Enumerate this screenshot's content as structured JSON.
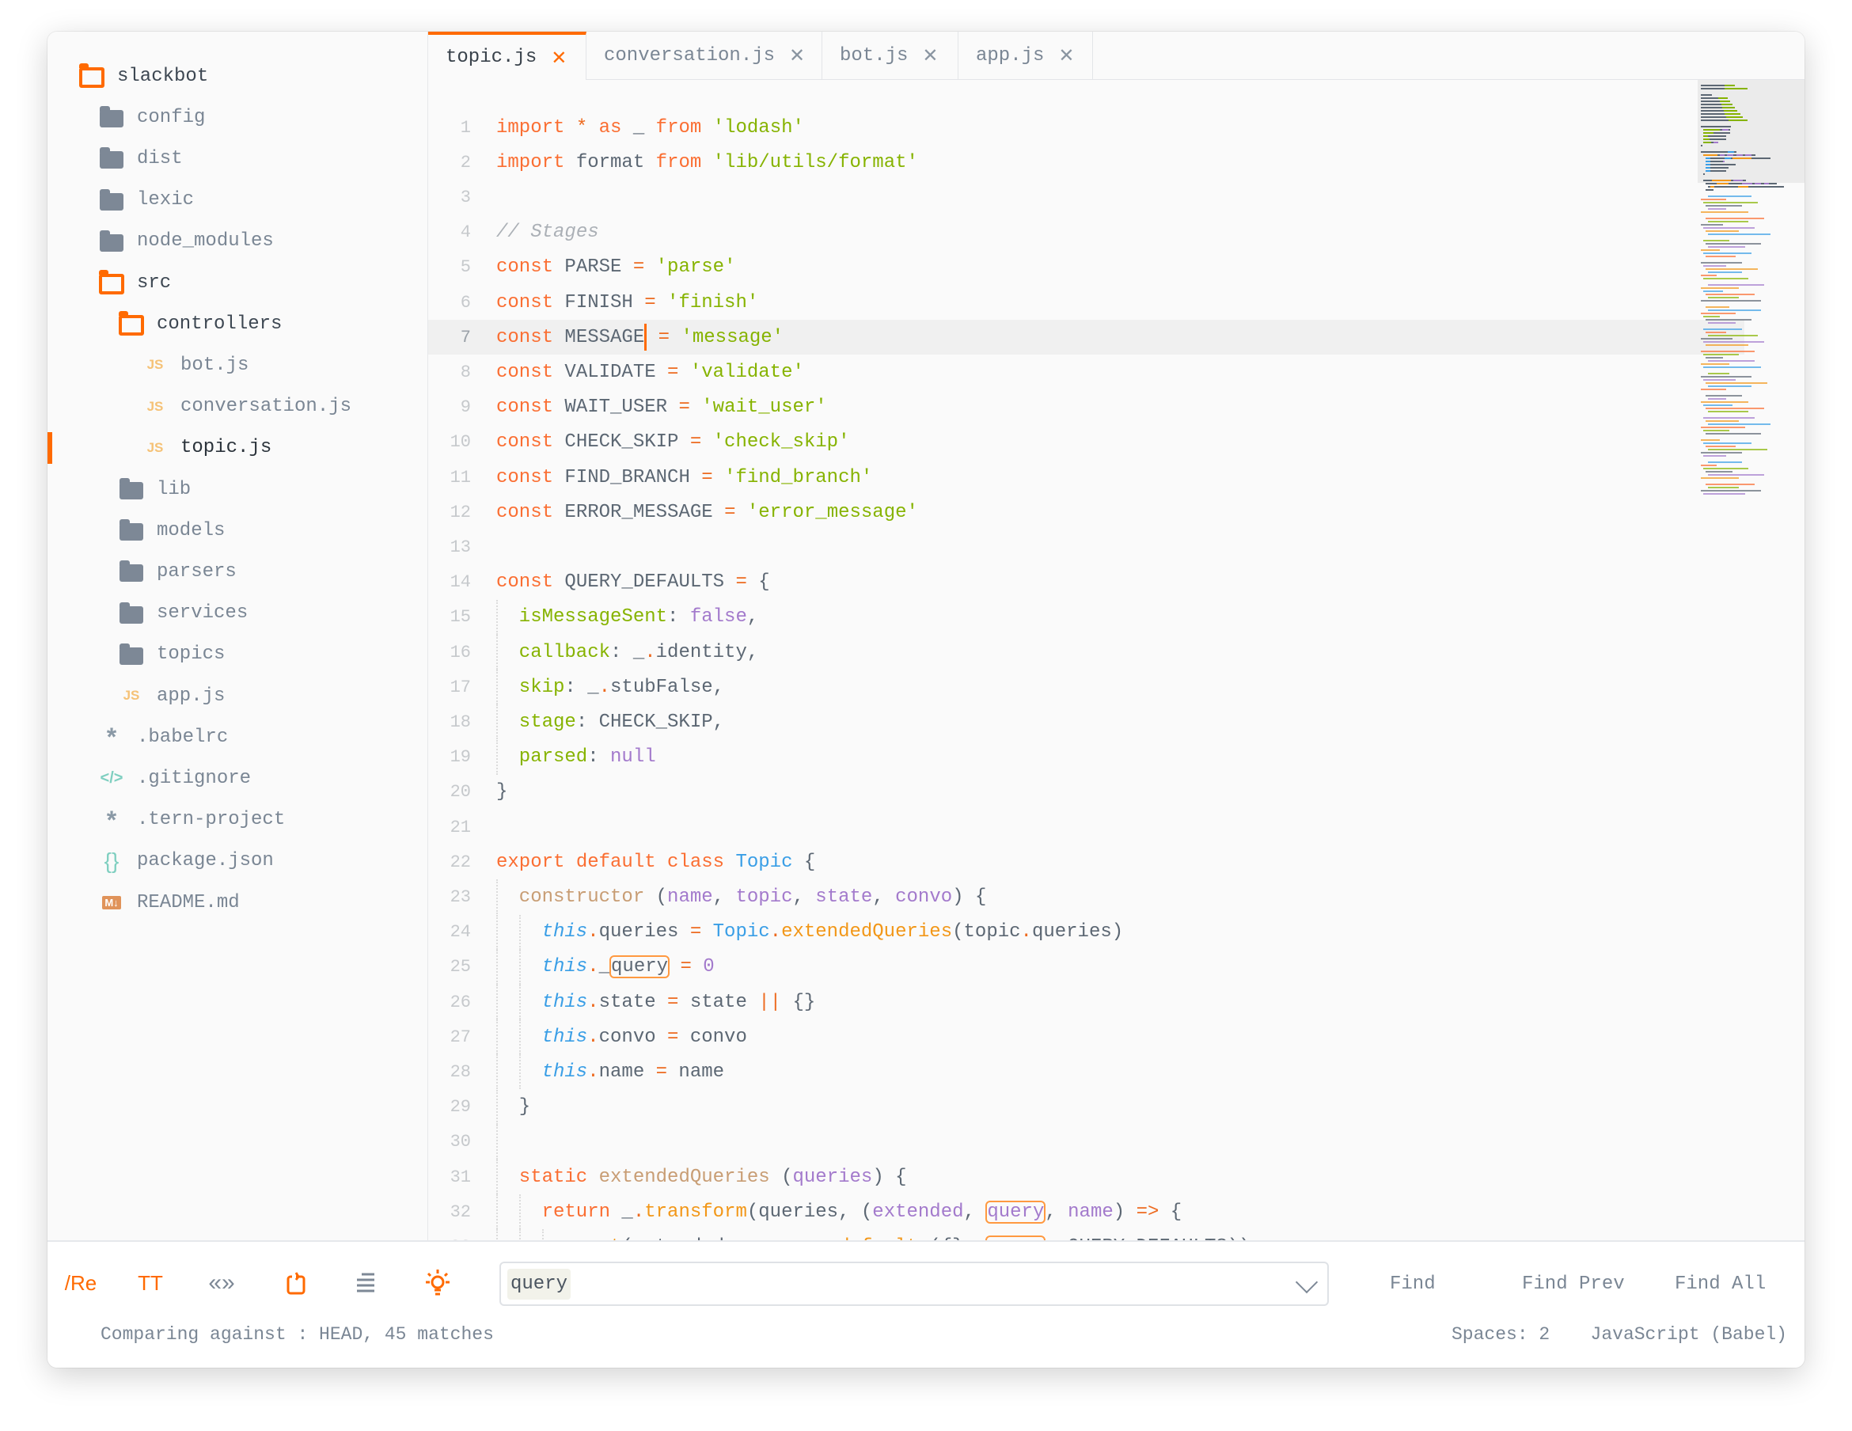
{
  "colors": {
    "accent": "#ff6a00",
    "keyword": "#fa6e32",
    "string": "#86b300",
    "function": "#f29718",
    "class": "#399ee6",
    "param": "#a37acc",
    "comment": "#abb0b6"
  },
  "sidebar": {
    "items": [
      {
        "label": "slackbot",
        "icon": "folder-open-icon",
        "level": 0,
        "open": true
      },
      {
        "label": "config",
        "icon": "folder-icon",
        "level": 1
      },
      {
        "label": "dist",
        "icon": "folder-icon",
        "level": 1
      },
      {
        "label": "lexic",
        "icon": "folder-icon",
        "level": 1
      },
      {
        "label": "node_modules",
        "icon": "folder-icon",
        "level": 1
      },
      {
        "label": "src",
        "icon": "folder-open-icon",
        "level": 1,
        "open": true
      },
      {
        "label": "controllers",
        "icon": "folder-open-icon",
        "level": 2,
        "open": true
      },
      {
        "label": "bot.js",
        "icon": "js-file-icon",
        "level": 3
      },
      {
        "label": "conversation.js",
        "icon": "js-file-icon",
        "level": 3
      },
      {
        "label": "topic.js",
        "icon": "js-file-icon",
        "level": 3,
        "active": true
      },
      {
        "label": "lib",
        "icon": "folder-icon",
        "level": 2
      },
      {
        "label": "models",
        "icon": "folder-icon",
        "level": 2
      },
      {
        "label": "parsers",
        "icon": "folder-icon",
        "level": 2
      },
      {
        "label": "services",
        "icon": "folder-icon",
        "level": 2
      },
      {
        "label": "topics",
        "icon": "folder-icon",
        "level": 2
      },
      {
        "label": "app.js",
        "icon": "js-file-icon",
        "level": 2
      },
      {
        "label": ".babelrc",
        "icon": "asterisk-icon",
        "level": 1
      },
      {
        "label": ".gitignore",
        "icon": "code-icon",
        "level": 1
      },
      {
        "label": ".tern-project",
        "icon": "asterisk-icon",
        "level": 1
      },
      {
        "label": "package.json",
        "icon": "braces-icon",
        "level": 1
      },
      {
        "label": "README.md",
        "icon": "markdown-icon",
        "level": 1
      }
    ]
  },
  "tabs": [
    {
      "label": "topic.js",
      "active": true
    },
    {
      "label": "conversation.js"
    },
    {
      "label": "bot.js"
    },
    {
      "label": "app.js"
    }
  ],
  "editor": {
    "current_line": 7,
    "lines": [
      [
        [
          "kw",
          "import"
        ],
        [
          "op",
          " * "
        ],
        [
          "kw",
          "as"
        ],
        [
          "p",
          " _ "
        ],
        [
          "kw",
          "from"
        ],
        [
          "p",
          " "
        ],
        [
          "str",
          "'lodash'"
        ]
      ],
      [
        [
          "kw",
          "import"
        ],
        [
          "p",
          " format "
        ],
        [
          "kw",
          "from"
        ],
        [
          "p",
          " "
        ],
        [
          "str",
          "'lib/utils/format'"
        ]
      ],
      [],
      [
        [
          "cm",
          "// Stages"
        ]
      ],
      [
        [
          "kw",
          "const"
        ],
        [
          "p",
          " PARSE "
        ],
        [
          "op",
          "="
        ],
        [
          "p",
          " "
        ],
        [
          "str",
          "'parse'"
        ]
      ],
      [
        [
          "kw",
          "const"
        ],
        [
          "p",
          " FINISH "
        ],
        [
          "op",
          "="
        ],
        [
          "p",
          " "
        ],
        [
          "str",
          "'finish'"
        ]
      ],
      [
        [
          "kw",
          "const"
        ],
        [
          "p",
          " MESSAGE"
        ],
        [
          "cur",
          ""
        ],
        [
          "p",
          " "
        ],
        [
          "op",
          "="
        ],
        [
          "p",
          " "
        ],
        [
          "str",
          "'message'"
        ]
      ],
      [
        [
          "kw",
          "const"
        ],
        [
          "p",
          " VALIDATE "
        ],
        [
          "op",
          "="
        ],
        [
          "p",
          " "
        ],
        [
          "str",
          "'validate'"
        ]
      ],
      [
        [
          "kw",
          "const"
        ],
        [
          "p",
          " WAIT_USER "
        ],
        [
          "op",
          "="
        ],
        [
          "p",
          " "
        ],
        [
          "str",
          "'wait_user'"
        ]
      ],
      [
        [
          "kw",
          "const"
        ],
        [
          "p",
          " CHECK_SKIP "
        ],
        [
          "op",
          "="
        ],
        [
          "p",
          " "
        ],
        [
          "str",
          "'check_skip'"
        ]
      ],
      [
        [
          "kw",
          "const"
        ],
        [
          "p",
          " FIND_BRANCH "
        ],
        [
          "op",
          "="
        ],
        [
          "p",
          " "
        ],
        [
          "str",
          "'find_branch'"
        ]
      ],
      [
        [
          "kw",
          "const"
        ],
        [
          "p",
          " ERROR_MESSAGE "
        ],
        [
          "op",
          "="
        ],
        [
          "p",
          " "
        ],
        [
          "str",
          "'error_message'"
        ]
      ],
      [],
      [
        [
          "kw",
          "const"
        ],
        [
          "p",
          " QUERY_DEFAULTS "
        ],
        [
          "op",
          "="
        ],
        [
          "p",
          " {"
        ]
      ],
      [
        [
          "ind",
          1
        ],
        [
          "prop",
          "isMessageSent"
        ],
        [
          "p",
          ": "
        ],
        [
          "num",
          "false"
        ],
        [
          "p",
          ","
        ]
      ],
      [
        [
          "ind",
          1
        ],
        [
          "prop",
          "callback"
        ],
        [
          "p",
          ": _"
        ],
        [
          "op",
          "."
        ],
        [
          "p",
          "identity,"
        ]
      ],
      [
        [
          "ind",
          1
        ],
        [
          "prop",
          "skip"
        ],
        [
          "p",
          ": _"
        ],
        [
          "op",
          "."
        ],
        [
          "p",
          "stubFalse,"
        ]
      ],
      [
        [
          "ind",
          1
        ],
        [
          "prop",
          "stage"
        ],
        [
          "p",
          ": CHECK_SKIP,"
        ]
      ],
      [
        [
          "ind",
          1
        ],
        [
          "prop",
          "parsed"
        ],
        [
          "p",
          ": "
        ],
        [
          "num",
          "null"
        ]
      ],
      [
        [
          "p",
          "}"
        ]
      ],
      [],
      [
        [
          "kw",
          "export default class"
        ],
        [
          "p",
          " "
        ],
        [
          "cls",
          "Topic"
        ],
        [
          "p",
          " {"
        ]
      ],
      [
        [
          "ind",
          1
        ],
        [
          "ctor",
          "constructor"
        ],
        [
          "p",
          " ("
        ],
        [
          "prm",
          "name"
        ],
        [
          "p",
          ", "
        ],
        [
          "prm",
          "topic"
        ],
        [
          "p",
          ", "
        ],
        [
          "prm",
          "state"
        ],
        [
          "p",
          ", "
        ],
        [
          "prm",
          "convo"
        ],
        [
          "p",
          ") {"
        ]
      ],
      [
        [
          "ind",
          2
        ],
        [
          "this",
          "this"
        ],
        [
          "op",
          "."
        ],
        [
          "p",
          "queries "
        ],
        [
          "op",
          "="
        ],
        [
          "p",
          " "
        ],
        [
          "cls",
          "Topic"
        ],
        [
          "op",
          "."
        ],
        [
          "fn",
          "extendedQueries"
        ],
        [
          "p",
          "(topic"
        ],
        [
          "op",
          "."
        ],
        [
          "p",
          "queries)"
        ]
      ],
      [
        [
          "ind",
          2
        ],
        [
          "this",
          "this"
        ],
        [
          "op",
          "."
        ],
        [
          "p",
          "_"
        ],
        [
          "match",
          "query"
        ],
        [
          "p",
          " "
        ],
        [
          "op",
          "="
        ],
        [
          "p",
          " "
        ],
        [
          "num",
          "0"
        ]
      ],
      [
        [
          "ind",
          2
        ],
        [
          "this",
          "this"
        ],
        [
          "op",
          "."
        ],
        [
          "p",
          "state "
        ],
        [
          "op",
          "="
        ],
        [
          "p",
          " state "
        ],
        [
          "op",
          "||"
        ],
        [
          "p",
          " {}"
        ]
      ],
      [
        [
          "ind",
          2
        ],
        [
          "this",
          "this"
        ],
        [
          "op",
          "."
        ],
        [
          "p",
          "convo "
        ],
        [
          "op",
          "="
        ],
        [
          "p",
          " convo"
        ]
      ],
      [
        [
          "ind",
          2
        ],
        [
          "this",
          "this"
        ],
        [
          "op",
          "."
        ],
        [
          "p",
          "name "
        ],
        [
          "op",
          "="
        ],
        [
          "p",
          " name"
        ]
      ],
      [
        [
          "ind",
          1
        ],
        [
          "p",
          "}"
        ]
      ],
      [
        [
          "ind",
          1
        ]
      ],
      [
        [
          "ind",
          1
        ],
        [
          "kw",
          "static"
        ],
        [
          "p",
          " "
        ],
        [
          "ctor",
          "extendedQueries"
        ],
        [
          "p",
          " ("
        ],
        [
          "prm",
          "queries"
        ],
        [
          "p",
          ") {"
        ]
      ],
      [
        [
          "ind",
          2
        ],
        [
          "kw",
          "return"
        ],
        [
          "p",
          " _"
        ],
        [
          "op",
          "."
        ],
        [
          "fn",
          "transform"
        ],
        [
          "p",
          "(queries, ("
        ],
        [
          "prm",
          "extended"
        ],
        [
          "p",
          ", "
        ],
        [
          "matchprm",
          "query"
        ],
        [
          "p",
          ", "
        ],
        [
          "prm",
          "name"
        ],
        [
          "p",
          ") "
        ],
        [
          "op",
          "=>"
        ],
        [
          "p",
          " {"
        ]
      ],
      [
        [
          "ind",
          3
        ],
        [
          "p",
          "_"
        ],
        [
          "op",
          "."
        ],
        [
          "fn",
          "set"
        ],
        [
          "p",
          "(extended, name, _"
        ],
        [
          "op",
          "."
        ],
        [
          "fn",
          "defaults"
        ],
        [
          "p",
          "({}, "
        ],
        [
          "match",
          "query"
        ],
        [
          "p",
          ", QUERY_DEFAULTS))"
        ]
      ],
      [
        [
          "ind",
          2
        ],
        [
          "p",
          "}, {})"
        ]
      ]
    ]
  },
  "findbar": {
    "tools": [
      {
        "name": "regex-toggle",
        "label": "/Re",
        "active": true
      },
      {
        "name": "case-sensitive-toggle",
        "label": "TT",
        "active": true
      },
      {
        "name": "whole-word-toggle",
        "label": "«»",
        "active": false
      },
      {
        "name": "wrap-toggle",
        "icon": "wrap-icon",
        "active": true
      },
      {
        "name": "in-selection-toggle",
        "icon": "lines-icon",
        "active": false
      },
      {
        "name": "highlight-matches-toggle",
        "icon": "lightbulb-icon",
        "active": true
      }
    ],
    "query": "query",
    "find": "Find",
    "find_prev": "Find Prev",
    "find_all": "Find All"
  },
  "status": {
    "left": "Comparing against : HEAD, 45 matches",
    "spaces": "Spaces: 2",
    "syntax": "JavaScript (Babel)"
  }
}
